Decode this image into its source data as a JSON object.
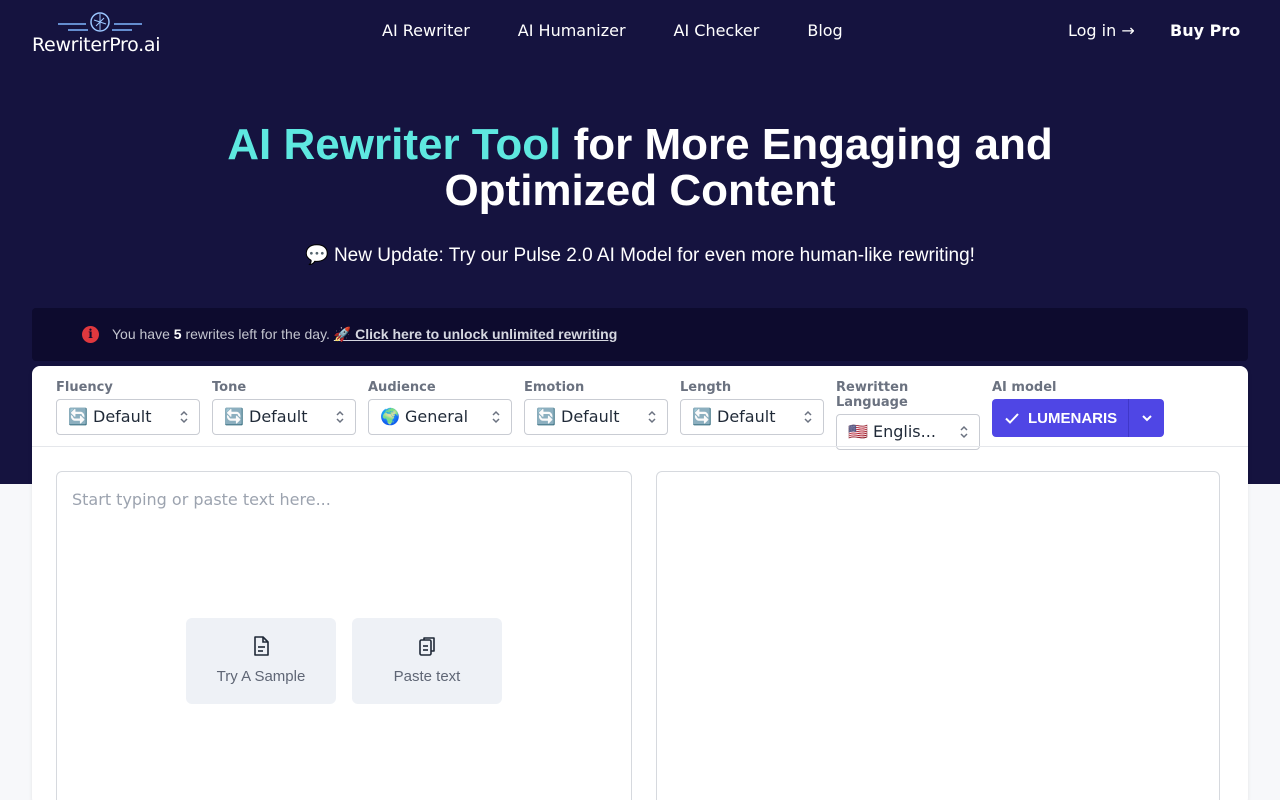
{
  "header": {
    "logo_text": "RewriterPro.ai",
    "nav": [
      "AI Rewriter",
      "AI Humanizer",
      "AI Checker",
      "Blog"
    ],
    "login_label": "Log in →",
    "buy_label": "Buy Pro"
  },
  "hero": {
    "title_accent": "AI Rewriter Tool",
    "title_rest": " for More Engaging and",
    "title_line2": "Optimized Content",
    "update": "💬 New Update: Try our Pulse 2.0 AI Model for even more human-like rewriting!"
  },
  "alert": {
    "prefix": "You have ",
    "count": "5",
    "suffix": " rewrites left for the day. ",
    "link": "🚀 Click here to unlock unlimited rewriting"
  },
  "controls": [
    {
      "label": "Fluency",
      "value": "🔄 Default"
    },
    {
      "label": "Tone",
      "value": "🔄 Default"
    },
    {
      "label": "Audience",
      "value": "🌍 General"
    },
    {
      "label": "Emotion",
      "value": "🔄 Default"
    },
    {
      "label": "Length",
      "value": "🔄 Default"
    },
    {
      "label": "Rewritten Language",
      "value": "🇺🇸 Englis..."
    }
  ],
  "ai_model": {
    "label": "AI model",
    "value": "LUMENARIS"
  },
  "editor": {
    "placeholder": "Start typing or paste text here...",
    "sample_label": "Try A Sample",
    "paste_label": "Paste text"
  },
  "colors": {
    "hero_bg": "#15133f",
    "accent_cyan": "#5ee8e0",
    "primary_button": "#4f46e5",
    "alert_icon": "#e0383e"
  }
}
